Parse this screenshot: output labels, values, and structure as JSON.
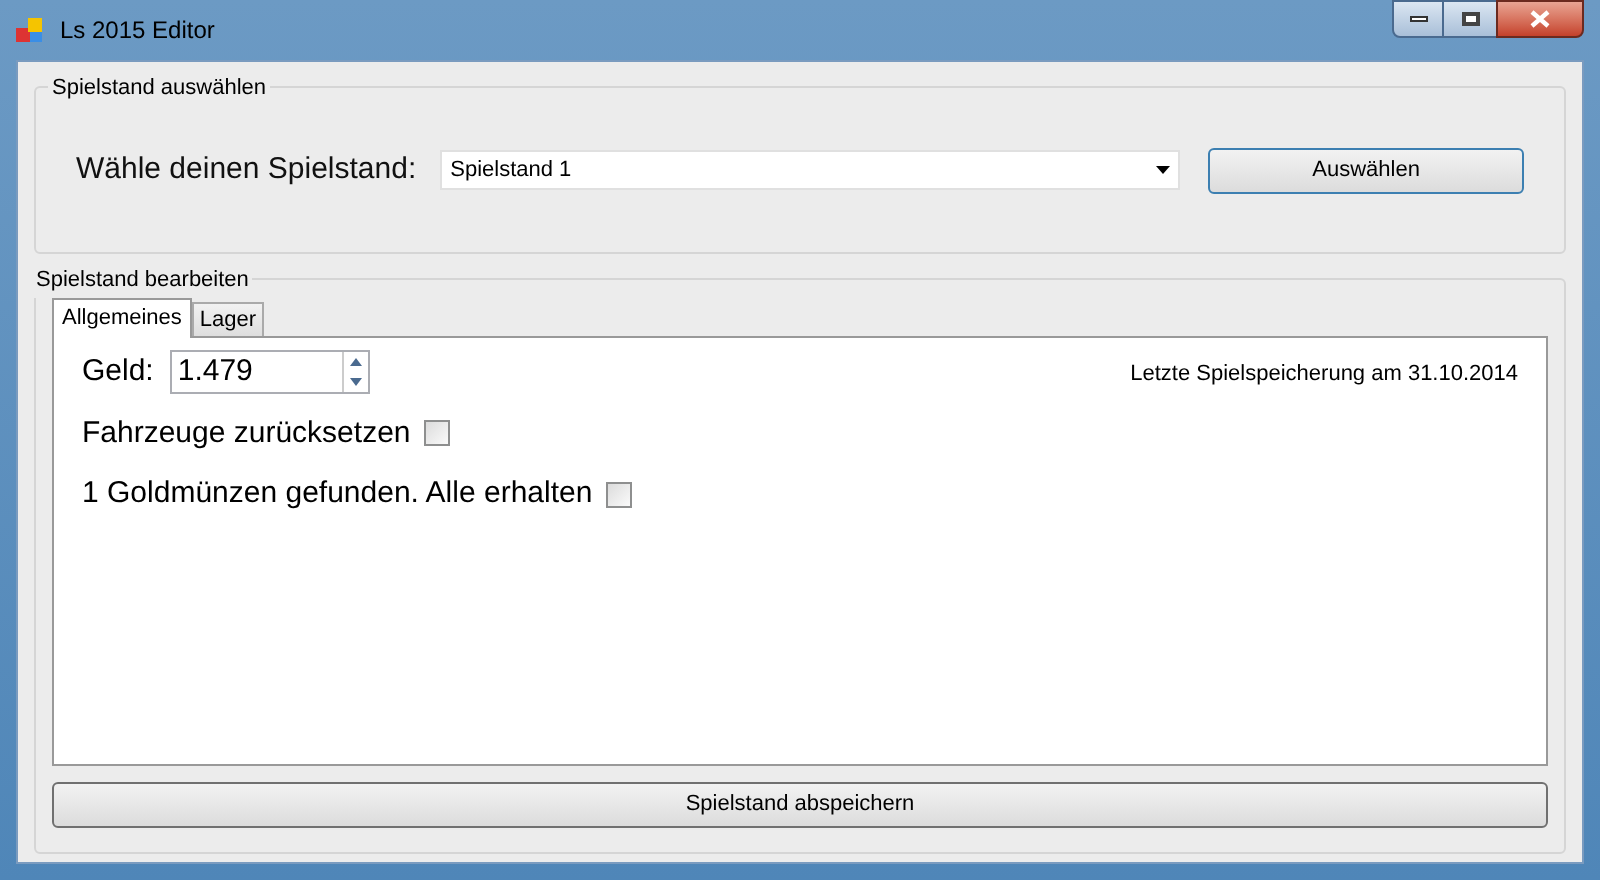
{
  "window": {
    "title": "Ls 2015 Editor"
  },
  "select_group": {
    "title": "Spielstand auswählen",
    "label": "Wähle deinen Spielstand:",
    "value": "Spielstand 1",
    "button": "Auswählen"
  },
  "edit_group": {
    "title": "Spielstand bearbeiten",
    "tabs": [
      {
        "label": "Allgemeines",
        "selected": true
      },
      {
        "label": "Lager",
        "selected": false
      }
    ],
    "last_save": "Letzte Spielspeicherung am 31.10.2014",
    "fields": [
      {
        "kind": "spinner",
        "label": "Geld:",
        "value": "1.479"
      },
      {
        "kind": "checkbox",
        "label": "Fahrzeuge zurücksetzen",
        "checked": false
      },
      {
        "kind": "checkbox",
        "label": "1 Goldmünzen gefunden. Alle erhalten",
        "checked": false
      }
    ],
    "save_button": "Spielstand abspeichern"
  }
}
